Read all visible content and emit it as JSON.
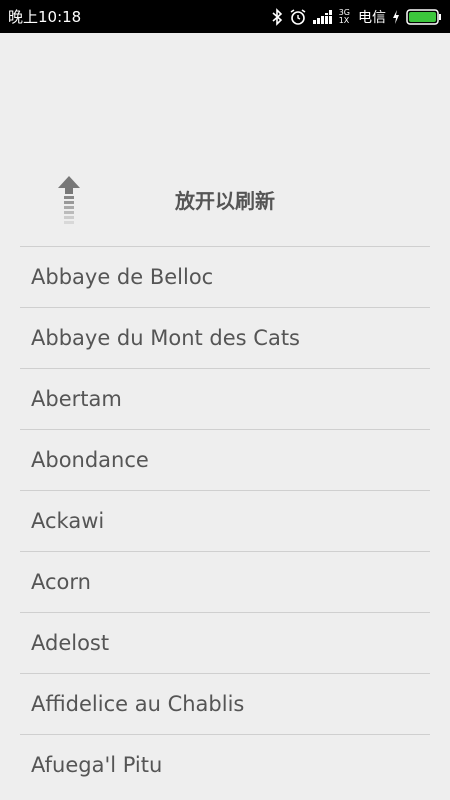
{
  "status_bar": {
    "time": "晚上10:18",
    "network_top": "3G",
    "network_bottom": "1X",
    "carrier": "电信"
  },
  "refresh": {
    "text": "放开以刷新"
  },
  "list": {
    "items": [
      {
        "label": "Abbaye de Belloc"
      },
      {
        "label": "Abbaye du Mont des Cats"
      },
      {
        "label": "Abertam"
      },
      {
        "label": "Abondance"
      },
      {
        "label": "Ackawi"
      },
      {
        "label": "Acorn"
      },
      {
        "label": "Adelost"
      },
      {
        "label": "Affidelice au Chablis"
      },
      {
        "label": "Afuega'l Pitu"
      }
    ]
  },
  "colors": {
    "background": "#eeeeee",
    "status_bar": "#000000",
    "text": "#555555",
    "divider": "#cfcfcf",
    "battery": "#3cc63c"
  }
}
